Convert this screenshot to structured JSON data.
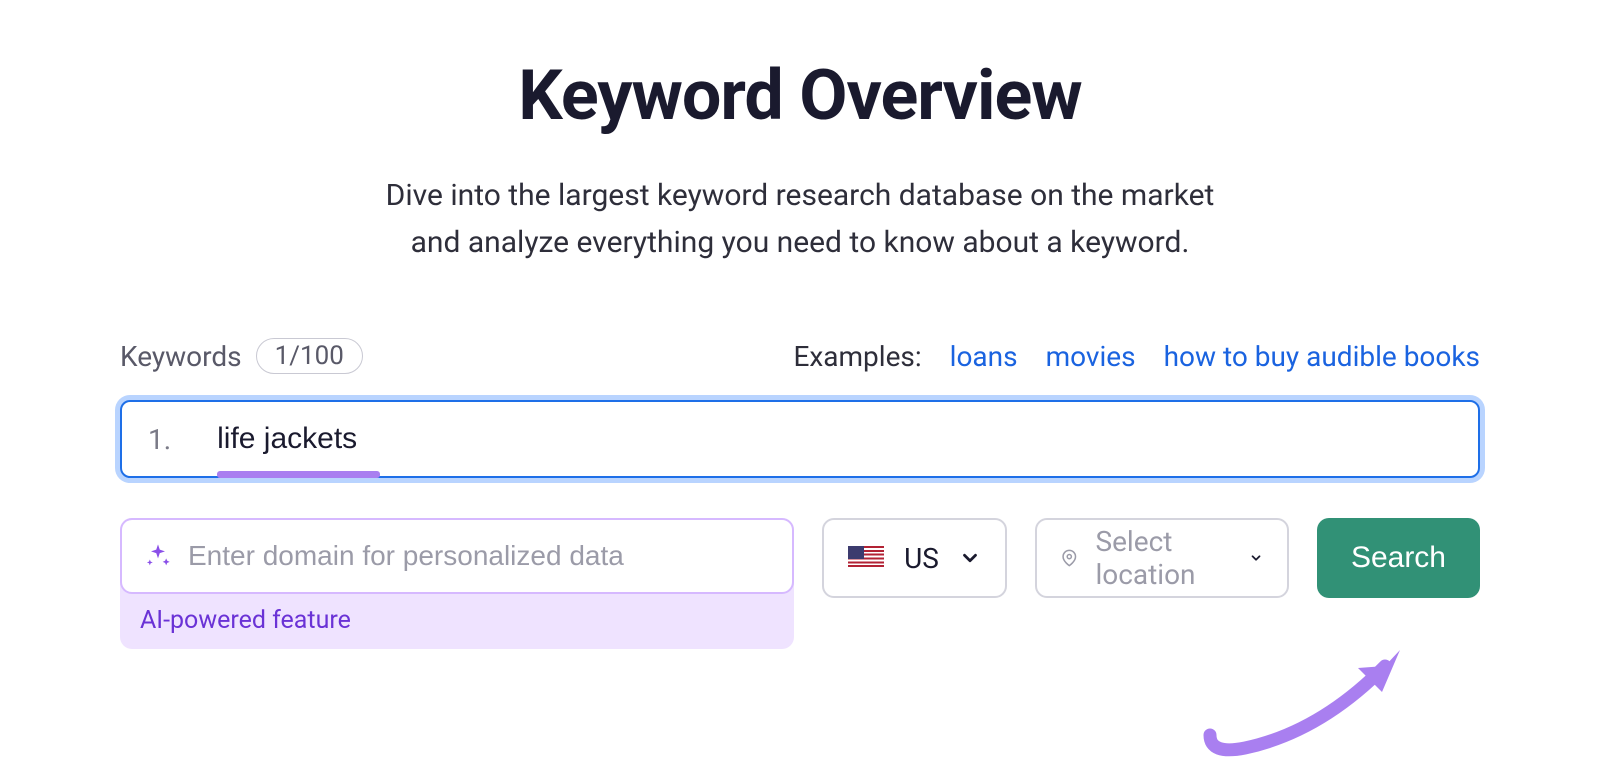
{
  "header": {
    "title": "Keyword Overview",
    "subtitle_line1": "Dive into the largest keyword research database on the market",
    "subtitle_line2": "and analyze everything you need to know about a keyword."
  },
  "keywords": {
    "label": "Keywords",
    "count": "1/100",
    "examples_label": "Examples:",
    "examples": [
      "loans",
      "movies",
      "how to buy audible books"
    ],
    "input_number": "1.",
    "input_value": "life jackets"
  },
  "domain": {
    "placeholder": "Enter domain for personalized data",
    "ai_label": "AI-powered feature"
  },
  "country": {
    "code": "US"
  },
  "location": {
    "placeholder": "Select location"
  },
  "search": {
    "label": "Search"
  },
  "colors": {
    "accent_blue": "#1a63e0",
    "accent_purple": "#a97ff0",
    "button_green": "#319176",
    "ai_purple_bg": "#efe3ff",
    "ai_purple_text": "#6a32d6"
  }
}
